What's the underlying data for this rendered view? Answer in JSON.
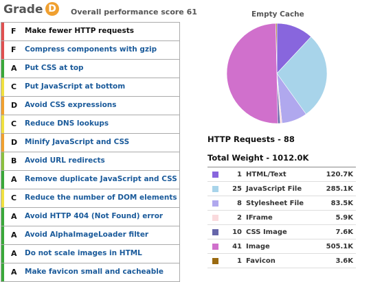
{
  "header": {
    "grade_label": "Grade",
    "grade_letter": "D",
    "overall_text": "Overall performance score 61"
  },
  "rules": [
    {
      "grade": "F",
      "label": "Make fewer HTTP requests",
      "color": "#e05050",
      "active": true
    },
    {
      "grade": "F",
      "label": "Compress components with gzip",
      "color": "#e05050"
    },
    {
      "grade": "A",
      "label": "Put CSS at top",
      "color": "#3aa83a"
    },
    {
      "grade": "C",
      "label": "Put JavaScript at bottom",
      "color": "#f0e040"
    },
    {
      "grade": "D",
      "label": "Avoid CSS expressions",
      "color": "#f0a030"
    },
    {
      "grade": "C",
      "label": "Reduce DNS lookups",
      "color": "#f0e040"
    },
    {
      "grade": "D",
      "label": "Minify JavaScript and CSS",
      "color": "#f0a030"
    },
    {
      "grade": "B",
      "label": "Avoid URL redirects",
      "color": "#8cc040"
    },
    {
      "grade": "A",
      "label": "Remove duplicate JavaScript and CSS",
      "color": "#3aa83a"
    },
    {
      "grade": "C",
      "label": "Reduce the number of DOM elements",
      "color": "#f0e040"
    },
    {
      "grade": "A",
      "label": "Avoid HTTP 404 (Not Found) error",
      "color": "#3aa83a"
    },
    {
      "grade": "A",
      "label": "Avoid AlphaImageLoader filter",
      "color": "#3aa83a"
    },
    {
      "grade": "A",
      "label": "Do not scale images in HTML",
      "color": "#3aa83a"
    },
    {
      "grade": "A",
      "label": "Make favicon small and cacheable",
      "color": "#3aa83a"
    }
  ],
  "stats": {
    "chart_title": "Empty Cache",
    "requests_text": "HTTP Requests - 88",
    "weight_text": "Total Weight - 1012.0K"
  },
  "components": [
    {
      "count": "1",
      "type": "HTML/Text",
      "size": "120.7K",
      "kb": 120.7,
      "color": "#8866dd"
    },
    {
      "count": "25",
      "type": "JavaScript File",
      "size": "285.1K",
      "kb": 285.1,
      "color": "#a8d4ea"
    },
    {
      "count": "8",
      "type": "Stylesheet File",
      "size": "83.5K",
      "kb": 83.5,
      "color": "#b0a8ee"
    },
    {
      "count": "2",
      "type": "IFrame",
      "size": "5.9K",
      "kb": 5.9,
      "color": "#fadadd"
    },
    {
      "count": "10",
      "type": "CSS Image",
      "size": "7.6K",
      "kb": 7.6,
      "color": "#6666aa"
    },
    {
      "count": "41",
      "type": "Image",
      "size": "505.1K",
      "kb": 505.1,
      "color": "#d070cc"
    },
    {
      "count": "1",
      "type": "Favicon",
      "size": "3.6K",
      "kb": 3.6,
      "color": "#9a6a10"
    }
  ]
}
